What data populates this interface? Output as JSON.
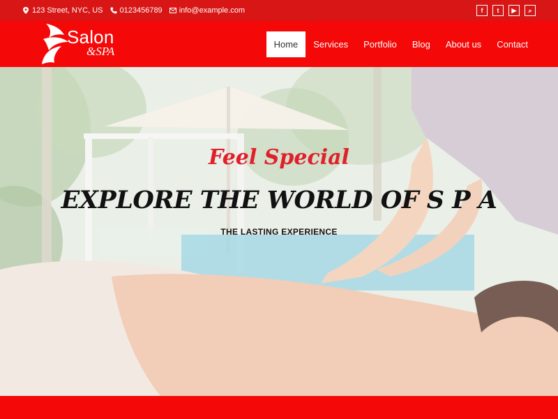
{
  "topbar": {
    "address": "123 Street, NYC, US",
    "phone": "0123456789",
    "email": "info@example.com",
    "social": [
      "f",
      "t",
      "▶",
      "⌕"
    ]
  },
  "logo": {
    "name": "Salon",
    "sub": "&SPA"
  },
  "nav": {
    "items": [
      "Home",
      "Services",
      "Portfolio",
      "Blog",
      "About us",
      "Contact"
    ],
    "active": "Home"
  },
  "hero": {
    "tagline": "Feel Special",
    "headline": "EXPLORE THE WORLD OF S P A",
    "subline": "THE LASTING EXPERIENCE"
  },
  "colors": {
    "topbar": "#d81616",
    "header": "#f40808",
    "accent_text": "#e0202a"
  }
}
